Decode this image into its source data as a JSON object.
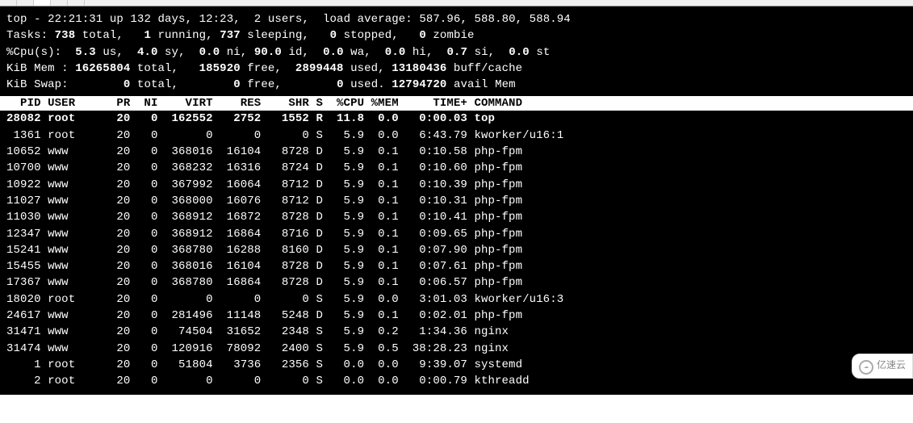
{
  "summary": {
    "line1": {
      "prefix": "top - ",
      "time": "22:21:31",
      "uptime": " up 132 days, 12:23,  ",
      "users": "2 users",
      "loadlabel": ",  load average: ",
      "load": "587.96, 588.80, 588.94"
    },
    "tasks": {
      "label": "Tasks: ",
      "total": "738",
      "totallbl": " total,   ",
      "running": "1",
      "runlbl": " running, ",
      "sleeping": "737",
      "sleeplbl": " sleeping,   ",
      "stopped": "0",
      "stoplbl": " stopped,   ",
      "zombie": "0",
      "zomlbl": " zombie"
    },
    "cpu": {
      "label": "%Cpu(s):  ",
      "us": "5.3",
      "uslbl": " us,  ",
      "sy": "4.0",
      "sylbl": " sy,  ",
      "ni": "0.0",
      "nilbl": " ni, ",
      "id": "90.0",
      "idlbl": " id,  ",
      "wa": "0.0",
      "walbl": " wa,  ",
      "hi": "0.0",
      "hilbl": " hi,  ",
      "si": "0.7",
      "silbl": " si,  ",
      "st": "0.0",
      "stlbl": " st"
    },
    "mem": {
      "label": "KiB Mem : ",
      "total": "16265804",
      "totlbl": " total,   ",
      "free": "185920",
      "freelbl": " free,  ",
      "used": "2899448",
      "usedlbl": " used, ",
      "buff": "13180436",
      "bufflbl": " buff/cache"
    },
    "swap": {
      "label": "KiB Swap:        ",
      "total": "0",
      "totlbl": " total,        ",
      "free": "0",
      "freelbl": " free,        ",
      "used": "0",
      "usedlbl": " used. ",
      "avail": "12794720",
      "availlbl": " avail Mem "
    }
  },
  "headers": "  PID USER      PR  NI    VIRT    RES    SHR S  %CPU %MEM     TIME+ COMMAND                                                      ",
  "processes": [
    {
      "pid": "28082",
      "user": "root",
      "pr": "20",
      "ni": "0",
      "virt": "162552",
      "res": "2752",
      "shr": "1552",
      "s": "R",
      "cpu": "11.8",
      "mem": "0.0",
      "time": "0:00.03",
      "cmd": "top",
      "hl": true
    },
    {
      "pid": "1361",
      "user": "root",
      "pr": "20",
      "ni": "0",
      "virt": "0",
      "res": "0",
      "shr": "0",
      "s": "S",
      "cpu": "5.9",
      "mem": "0.0",
      "time": "6:43.79",
      "cmd": "kworker/u16:1"
    },
    {
      "pid": "10652",
      "user": "www",
      "pr": "20",
      "ni": "0",
      "virt": "368016",
      "res": "16104",
      "shr": "8728",
      "s": "D",
      "cpu": "5.9",
      "mem": "0.1",
      "time": "0:10.58",
      "cmd": "php-fpm"
    },
    {
      "pid": "10700",
      "user": "www",
      "pr": "20",
      "ni": "0",
      "virt": "368232",
      "res": "16316",
      "shr": "8724",
      "s": "D",
      "cpu": "5.9",
      "mem": "0.1",
      "time": "0:10.60",
      "cmd": "php-fpm"
    },
    {
      "pid": "10922",
      "user": "www",
      "pr": "20",
      "ni": "0",
      "virt": "367992",
      "res": "16064",
      "shr": "8712",
      "s": "D",
      "cpu": "5.9",
      "mem": "0.1",
      "time": "0:10.39",
      "cmd": "php-fpm"
    },
    {
      "pid": "11027",
      "user": "www",
      "pr": "20",
      "ni": "0",
      "virt": "368000",
      "res": "16076",
      "shr": "8712",
      "s": "D",
      "cpu": "5.9",
      "mem": "0.1",
      "time": "0:10.31",
      "cmd": "php-fpm"
    },
    {
      "pid": "11030",
      "user": "www",
      "pr": "20",
      "ni": "0",
      "virt": "368912",
      "res": "16872",
      "shr": "8728",
      "s": "D",
      "cpu": "5.9",
      "mem": "0.1",
      "time": "0:10.41",
      "cmd": "php-fpm"
    },
    {
      "pid": "12347",
      "user": "www",
      "pr": "20",
      "ni": "0",
      "virt": "368912",
      "res": "16864",
      "shr": "8716",
      "s": "D",
      "cpu": "5.9",
      "mem": "0.1",
      "time": "0:09.65",
      "cmd": "php-fpm"
    },
    {
      "pid": "15241",
      "user": "www",
      "pr": "20",
      "ni": "0",
      "virt": "368780",
      "res": "16288",
      "shr": "8160",
      "s": "D",
      "cpu": "5.9",
      "mem": "0.1",
      "time": "0:07.90",
      "cmd": "php-fpm"
    },
    {
      "pid": "15455",
      "user": "www",
      "pr": "20",
      "ni": "0",
      "virt": "368016",
      "res": "16104",
      "shr": "8728",
      "s": "D",
      "cpu": "5.9",
      "mem": "0.1",
      "time": "0:07.61",
      "cmd": "php-fpm"
    },
    {
      "pid": "17367",
      "user": "www",
      "pr": "20",
      "ni": "0",
      "virt": "368780",
      "res": "16864",
      "shr": "8728",
      "s": "D",
      "cpu": "5.9",
      "mem": "0.1",
      "time": "0:06.57",
      "cmd": "php-fpm"
    },
    {
      "pid": "18020",
      "user": "root",
      "pr": "20",
      "ni": "0",
      "virt": "0",
      "res": "0",
      "shr": "0",
      "s": "S",
      "cpu": "5.9",
      "mem": "0.0",
      "time": "3:01.03",
      "cmd": "kworker/u16:3"
    },
    {
      "pid": "24617",
      "user": "www",
      "pr": "20",
      "ni": "0",
      "virt": "281496",
      "res": "11148",
      "shr": "5248",
      "s": "D",
      "cpu": "5.9",
      "mem": "0.1",
      "time": "0:02.01",
      "cmd": "php-fpm"
    },
    {
      "pid": "31471",
      "user": "www",
      "pr": "20",
      "ni": "0",
      "virt": "74504",
      "res": "31652",
      "shr": "2348",
      "s": "S",
      "cpu": "5.9",
      "mem": "0.2",
      "time": "1:34.36",
      "cmd": "nginx"
    },
    {
      "pid": "31474",
      "user": "www",
      "pr": "20",
      "ni": "0",
      "virt": "120916",
      "res": "78092",
      "shr": "2400",
      "s": "S",
      "cpu": "5.9",
      "mem": "0.5",
      "time": "38:28.23",
      "cmd": "nginx"
    },
    {
      "pid": "1",
      "user": "root",
      "pr": "20",
      "ni": "0",
      "virt": "51804",
      "res": "3736",
      "shr": "2356",
      "s": "S",
      "cpu": "0.0",
      "mem": "0.0",
      "time": "9:39.07",
      "cmd": "systemd"
    },
    {
      "pid": "2",
      "user": "root",
      "pr": "20",
      "ni": "0",
      "virt": "0",
      "res": "0",
      "shr": "0",
      "s": "S",
      "cpu": "0.0",
      "mem": "0.0",
      "time": "0:00.79",
      "cmd": "kthreadd"
    }
  ],
  "watermark": "亿速云"
}
